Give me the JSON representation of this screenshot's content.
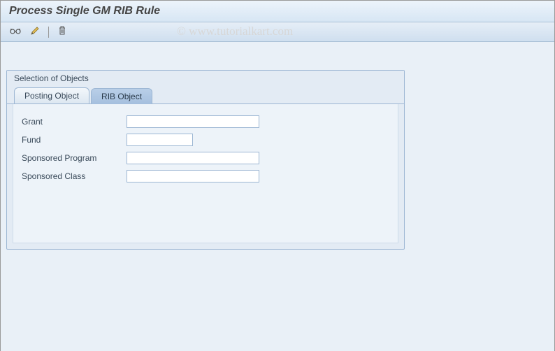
{
  "header": {
    "title": "Process Single GM RIB Rule"
  },
  "toolbar": {
    "buttons": [
      "glasses-icon",
      "pencil-icon",
      "trash-icon"
    ]
  },
  "watermark": "© www.tutorialkart.com",
  "panel": {
    "title": "Selection of Objects",
    "tabs": [
      {
        "label": "Posting Object",
        "active": false
      },
      {
        "label": "RIB Object",
        "active": true
      }
    ],
    "fields": {
      "grant": {
        "label": "Grant",
        "value": ""
      },
      "fund": {
        "label": "Fund",
        "value": ""
      },
      "sprog": {
        "label": "Sponsored Program",
        "value": ""
      },
      "sclass": {
        "label": "Sponsored Class",
        "value": ""
      }
    }
  }
}
